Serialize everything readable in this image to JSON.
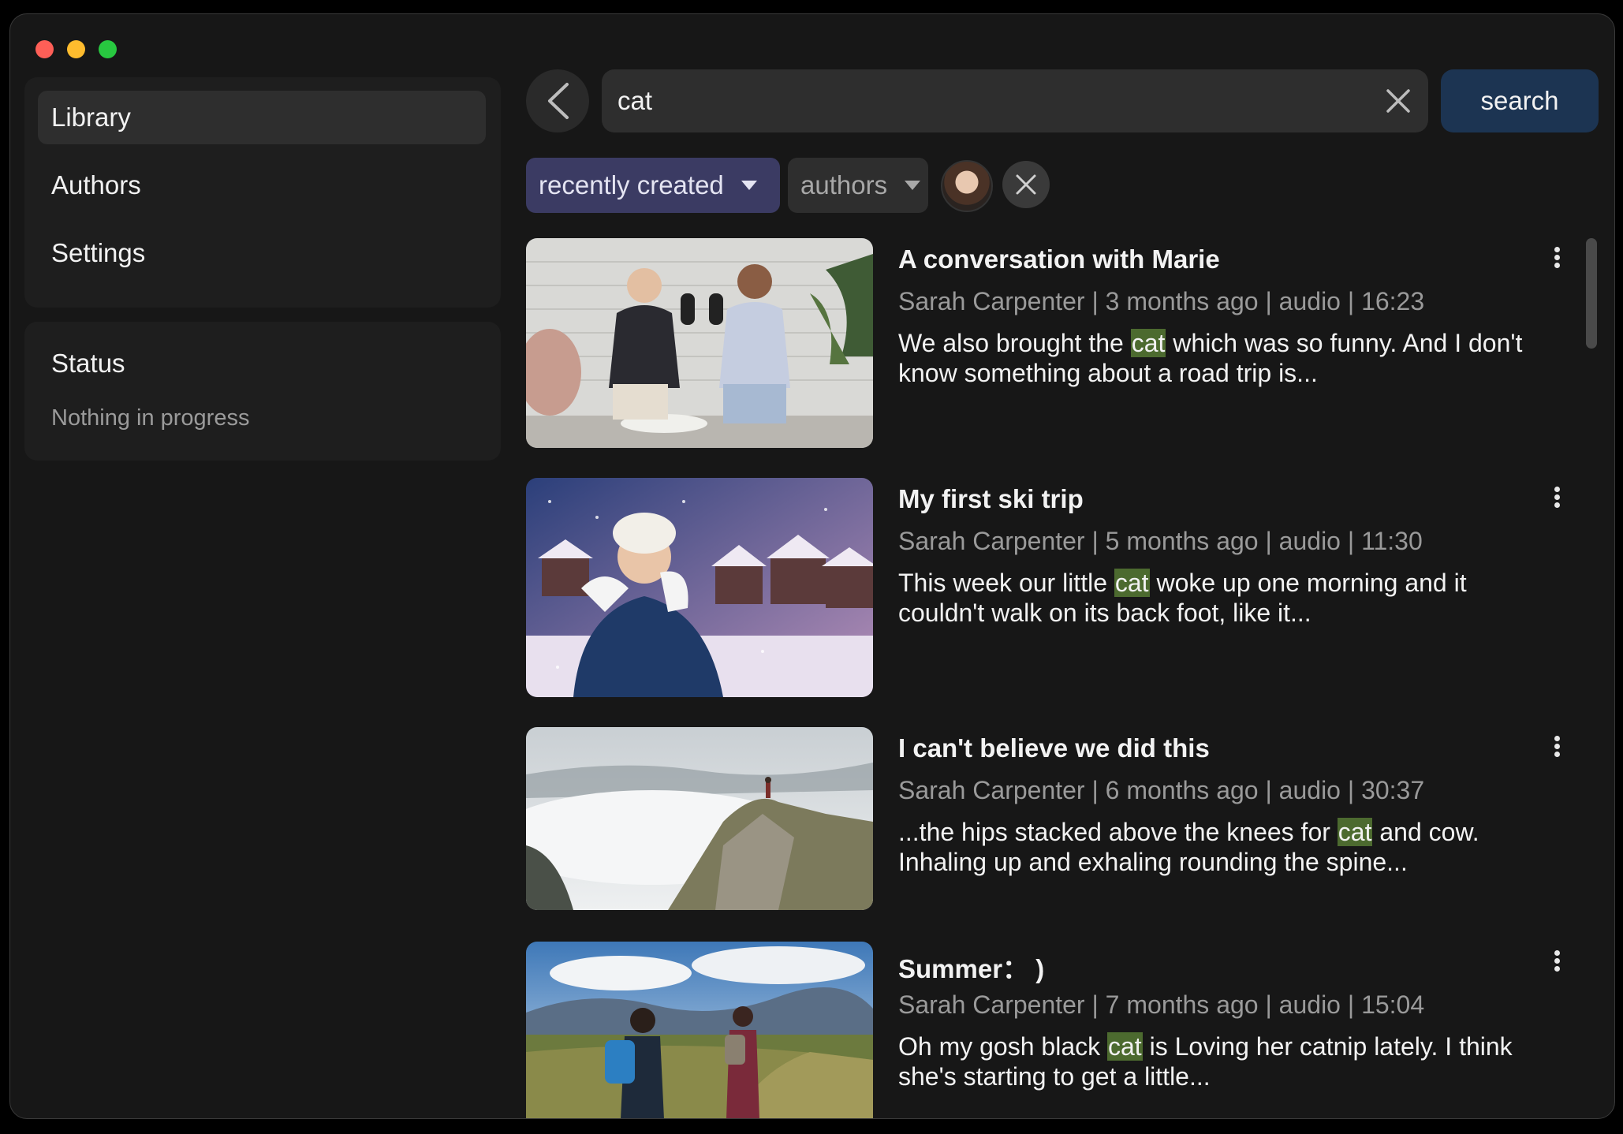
{
  "sidebar": {
    "items": [
      {
        "label": "Library",
        "active": true
      },
      {
        "label": "Authors",
        "active": false
      },
      {
        "label": "Settings",
        "active": false
      }
    ],
    "status": {
      "title": "Status",
      "text": "Nothing in progress"
    }
  },
  "search": {
    "value": "cat",
    "button_label": "search"
  },
  "filters": {
    "sort_label": "recently created",
    "authors_label": "authors"
  },
  "highlight_term": "cat",
  "results": [
    {
      "title": "A conversation with Marie",
      "meta": "Sarah Carpenter | 3 months ago | audio | 16:23",
      "snippet_before": "We also brought the ",
      "snippet_after": " which was so funny. And I don't know something about a road trip is...",
      "thumb": "podcast-studio"
    },
    {
      "title": "My first ski trip",
      "meta": "Sarah Carpenter | 5 months ago | audio | 11:30",
      "snippet_before": "This week our little ",
      "snippet_after": " woke up one morning and it couldn't walk on its back foot, like it...",
      "thumb": "winter-village"
    },
    {
      "title": "I can't believe we did this",
      "meta": "Sarah Carpenter | 6 months ago | audio | 30:37",
      "snippet_before": "...the hips stacked above the knees for ",
      "snippet_after": " and cow. Inhaling up and exhaling rounding the spine...",
      "thumb": "mountain-clouds"
    },
    {
      "title": "Summer： )",
      "meta": "Sarah Carpenter | 7 months ago | audio | 15:04",
      "snippet_before": "Oh my gosh black ",
      "snippet_after": " is Loving her catnip lately. I think she's starting to get a little...",
      "thumb": "hikers-valley"
    }
  ],
  "colors": {
    "window_bg": "#171717",
    "panel_bg": "#1e1e1e",
    "search_button": "#1c3452",
    "sort_chip": "#3b3b63",
    "highlight": "#4c6a2f"
  }
}
